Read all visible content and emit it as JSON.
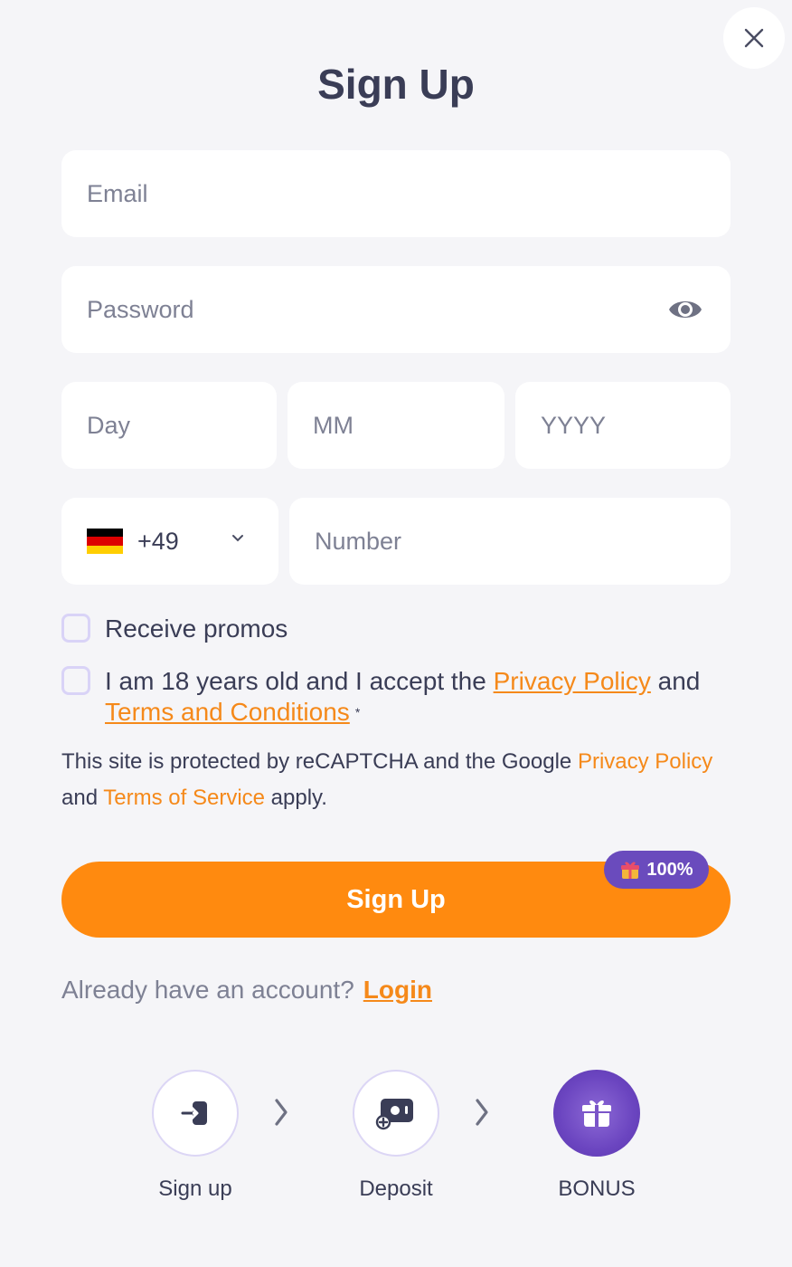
{
  "header": {
    "title": "Sign Up"
  },
  "close": {
    "icon": "close-icon"
  },
  "form": {
    "email_placeholder": "Email",
    "password_placeholder": "Password",
    "password_toggle_icon": "eye-icon",
    "day_placeholder": "Day",
    "month_placeholder": "MM",
    "year_placeholder": "YYYY",
    "country": {
      "flag": "germany-flag",
      "dial_code": "+49"
    },
    "number_placeholder": "Number"
  },
  "checkboxes": {
    "promos_label": "Receive promos",
    "terms": {
      "prefix": "I am 18 years old and I accept the ",
      "privacy_link": "Privacy Policy",
      "middle": " and",
      "terms_link": "Terms and Conditions",
      "required_mark": "*"
    }
  },
  "recaptcha": {
    "part1": "This site is protected by reCAPTCHA and the Google ",
    "privacy_link": "Privacy Policy",
    "part2": "and ",
    "terms_link": "Terms of Service",
    "part3": " apply."
  },
  "signup_button": {
    "label": "Sign Up",
    "badge": {
      "icon": "gift-icon",
      "text": "100%"
    }
  },
  "login": {
    "prompt": "Already have an account?",
    "link": "Login"
  },
  "steps": [
    {
      "label": "Sign up",
      "icon": "sign-in-icon"
    },
    {
      "label": "Deposit",
      "icon": "wallet-icon"
    },
    {
      "label": "BONUS",
      "icon": "gift-icon"
    }
  ],
  "colors": {
    "accent": "#ff8a0f",
    "link": "#f5891a",
    "badge": "#6a4bbd",
    "text": "#3a3d56",
    "background": "#f5f5f8"
  }
}
